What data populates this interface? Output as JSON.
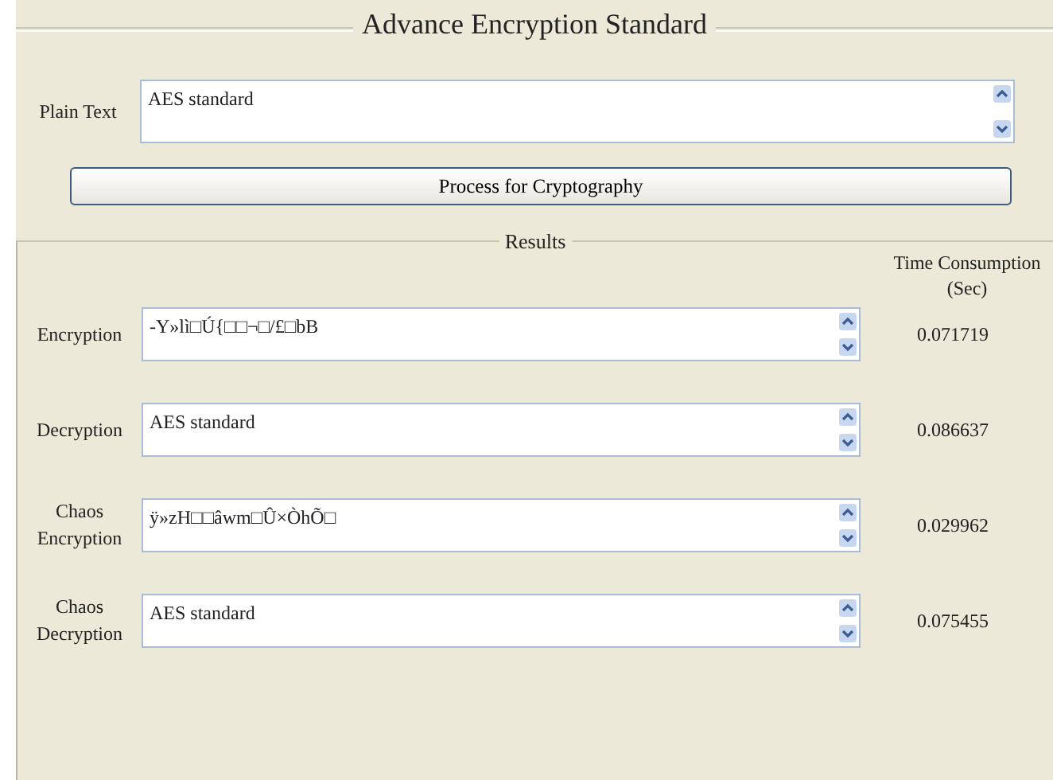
{
  "title": "Advance Encryption Standard",
  "plain_text": {
    "label": "Plain Text",
    "value": "AES standard"
  },
  "process_button": "Process for Cryptography",
  "results": {
    "legend": "Results",
    "time_header": "Time Consumption (Sec)",
    "rows": [
      {
        "label": "Encryption",
        "value": "-Y»lì□Ú{□□¬□/£□bB",
        "time": "0.071719"
      },
      {
        "label": "Decryption",
        "value": "AES standard",
        "time": "0.086637"
      },
      {
        "label": "Chaos Encryption",
        "value": "ÿ»zH□□âwm□Û×ÒhÕ□",
        "time": "0.029962"
      },
      {
        "label": "Chaos Decryption",
        "value": "AES standard",
        "time": "0.075455"
      }
    ]
  }
}
